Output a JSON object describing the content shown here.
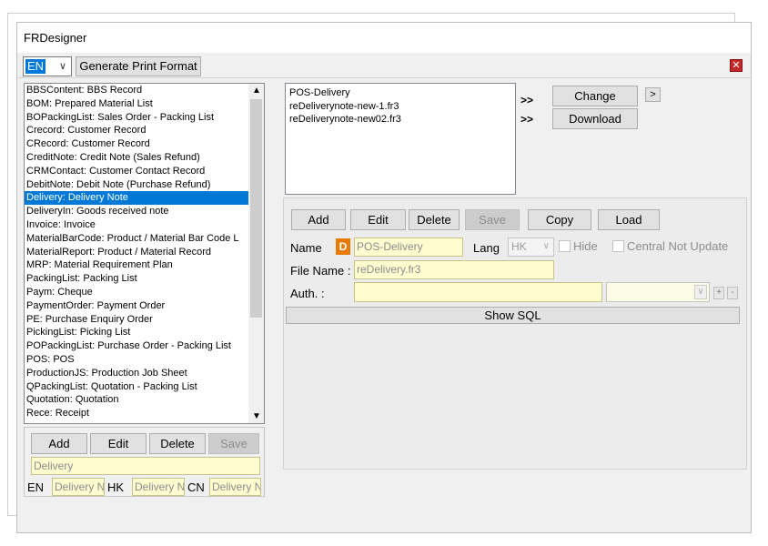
{
  "window": {
    "title": "FRDesigner"
  },
  "toolbar": {
    "language": "EN",
    "generate_label": "Generate Print Format",
    "close_label": "✕"
  },
  "record_list": {
    "items": [
      "BBSContent:  BBS Record",
      "BOM:  Prepared Material List",
      "BOPackingList:  Sales Order - Packing List",
      "Crecord:  Customer Record",
      "CRecord:  Customer Record",
      "CreditNote:  Credit Note (Sales Refund)",
      "CRMContact:  Customer Contact Record",
      "DebitNote:  Debit Note (Purchase Refund)",
      "Delivery:  Delivery Note",
      "DeliveryIn:  Goods received note",
      "Invoice:  Invoice",
      "MaterialBarCode:  Product / Material Bar Code L",
      "MaterialReport:  Product / Material Record",
      "MRP:  Material Requirement Plan",
      "PackingList:  Packing List",
      "Paym:  Cheque",
      "PaymentOrder:  Payment Order",
      "PE:  Purchase Enquiry Order",
      "PickingList:  Picking List",
      "POPackingList:  Purchase Order - Packing List",
      "POS:  POS",
      "ProductionJS:  Production Job Sheet",
      "QPackingList:  Quotation - Packing List",
      "Quotation:  Quotation",
      "Rece:  Receipt"
    ],
    "selected_index": 8
  },
  "left_buttons": {
    "add": "Add",
    "edit": "Edit",
    "delete": "Delete",
    "save": "Save"
  },
  "left_form": {
    "name_value": "Delivery",
    "en_label": "EN",
    "en_value": "Delivery N",
    "hk_label": "HK",
    "hk_value": "Delivery N",
    "cn_label": "CN",
    "cn_value": "Delivery N"
  },
  "file_list": {
    "items": [
      "POS-Delivery",
      "reDeliverynote-new-1.fr3",
      "reDeliverynote-new02.fr3"
    ]
  },
  "file_actions": {
    "arrow1": ">>",
    "arrow2": ">>",
    "change": "Change",
    "download": "Download",
    "more": ">"
  },
  "format_buttons": {
    "add": "Add",
    "edit": "Edit",
    "delete": "Delete",
    "save": "Save",
    "copy": "Copy",
    "load": "Load"
  },
  "format_form": {
    "name_label": "Name",
    "d_badge": "D",
    "name_value": "POS-Delivery",
    "lang_label": "Lang",
    "lang_value": "HK",
    "hide_label": "Hide",
    "central_label": "Central Not Update",
    "file_name_label": "File Name :",
    "file_name_value": "reDelivery.fr3",
    "auth_label": "Auth. :",
    "auth_value": "",
    "plus": "+",
    "minus": "-",
    "show_sql": "Show SQL"
  }
}
